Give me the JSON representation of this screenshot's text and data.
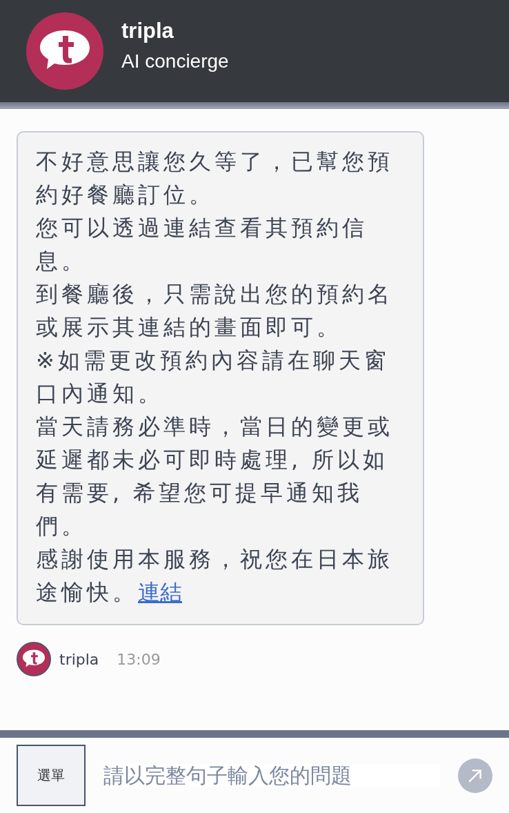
{
  "header": {
    "title": "tripla",
    "subtitle": "AI concierge"
  },
  "message": {
    "paragraphs": [
      "不好意思讓您久等了，已幫您預約好餐廳訂位。",
      "您可以透過連結查看其預約信息。",
      "到餐廳後，只需說出您的預約名或展示其連結的畫面即可。",
      "※如需更改預約內容請在聊天窗口內通知。",
      "當天請務必準時，當日的變更或延遲都未必可即時處理, 所以如有需要, 希望您可提早通知我們。",
      "感謝使用本服務，祝您在日本旅途愉快。"
    ],
    "link": "連結",
    "sender": "tripla",
    "time": "13:09"
  },
  "footer": {
    "menu_button": "選單",
    "input": {
      "placeholder": "請以完整句子輸入您的問題"
    }
  }
}
